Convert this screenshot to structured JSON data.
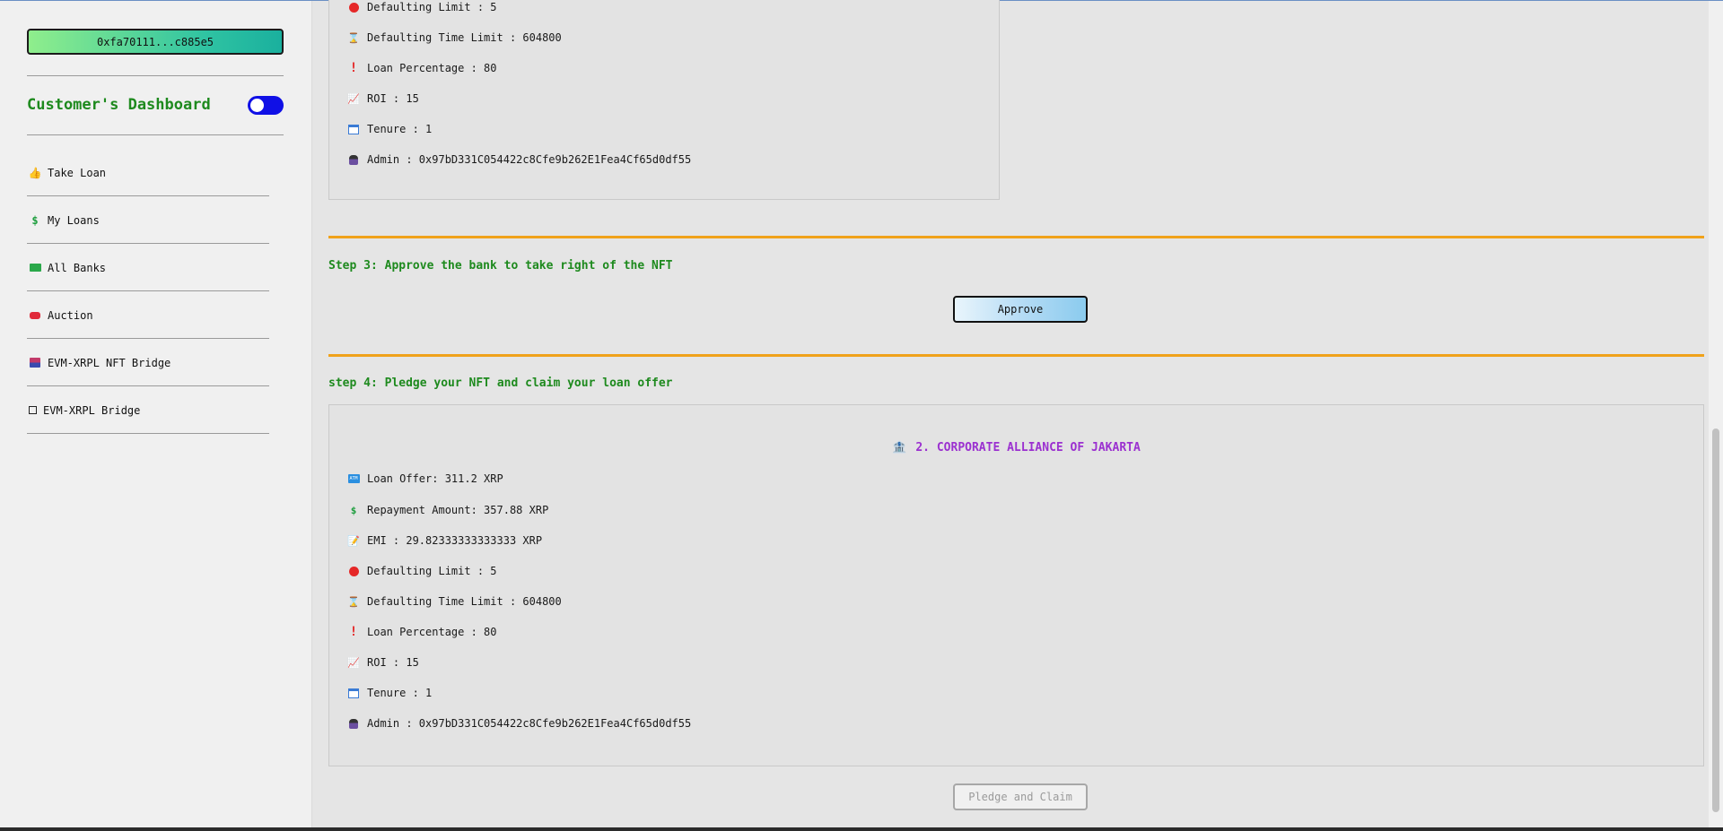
{
  "sidebar": {
    "wallet_address": "0xfa70111...c885e5",
    "dashboard_title": "Customer's Dashboard",
    "items": [
      {
        "label": "Take Loan",
        "icon": "money-bag-icon"
      },
      {
        "label": "My Loans",
        "icon": "dollar-icon"
      },
      {
        "label": "All Banks",
        "icon": "banknote-icon"
      },
      {
        "label": "Auction",
        "icon": "red-tag-icon"
      },
      {
        "label": "EVM-XRPL NFT Bridge",
        "icon": "bridge-icon"
      },
      {
        "label": "EVM-XRPL Bridge",
        "icon": "bridge-box-icon"
      }
    ]
  },
  "top_card": {
    "defaulting_limit": "Defaulting Limit : 5",
    "defaulting_time_limit": "Defaulting Time Limit : 604800",
    "loan_percentage": "Loan Percentage : 80",
    "roi": "ROI : 15",
    "tenure": "Tenure : 1",
    "admin": "Admin : 0x97bD331C054422c8Cfe9b262E1Fea4Cf65d0df55"
  },
  "step3": {
    "title": "Step 3: Approve the bank to take right of the NFT",
    "button_label": "Approve"
  },
  "step4": {
    "title": "step 4: Pledge your NFT and claim your loan offer",
    "card": {
      "bank_name": "2. CORPORATE ALLIANCE OF JAKARTA",
      "loan_offer": "Loan Offer: 311.2 XRP",
      "repayment_amount": "Repayment Amount: 357.88 XRP",
      "emi": "EMI : 29.82333333333333 XRP",
      "defaulting_limit": "Defaulting Limit : 5",
      "defaulting_time_limit": "Defaulting Time Limit : 604800",
      "loan_percentage": "Loan Percentage : 80",
      "roi": "ROI : 15",
      "tenure": "Tenure : 1",
      "admin": "Admin : 0x97bD331C054422c8Cfe9b262E1Fea4Cf65d0df55"
    },
    "button_label": "Pledge and Claim"
  },
  "colors": {
    "accent_green": "#1e8a1e",
    "orange_divider": "#f0a21a",
    "bank_purple": "#9b30d0",
    "toggle_blue": "#1010e6"
  }
}
